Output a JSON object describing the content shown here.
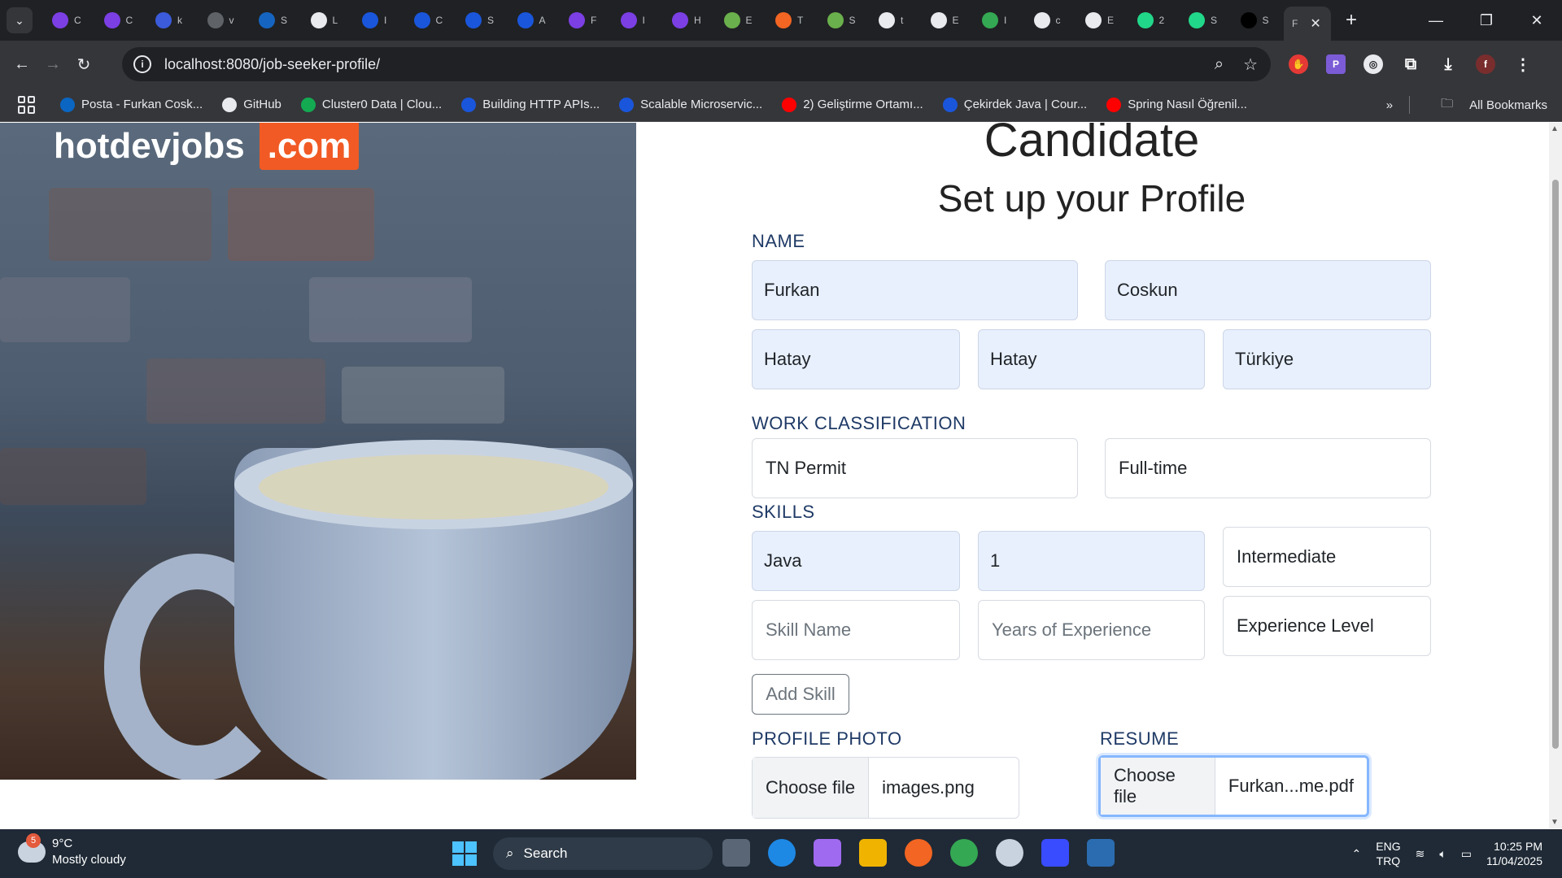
{
  "browser": {
    "tabs": [
      {
        "initial": "C",
        "color": "#7b3fe4",
        "icon": "u"
      },
      {
        "initial": "C",
        "color": "#7b3fe4",
        "icon": "u"
      },
      {
        "initial": "k",
        "color": "#3b5bdb",
        "icon": "q"
      },
      {
        "initial": "v",
        "color": "#5f6368",
        "icon": "globe"
      },
      {
        "initial": "S",
        "color": "#1565c0",
        "icon": "on"
      },
      {
        "initial": "L",
        "color": "#e8eaed",
        "icon": "w"
      },
      {
        "initial": "I",
        "color": "#1a56db",
        "icon": "c"
      },
      {
        "initial": "C",
        "color": "#1a56db",
        "icon": "c"
      },
      {
        "initial": "S",
        "color": "#1a56db",
        "icon": "c"
      },
      {
        "initial": "A",
        "color": "#1a56db",
        "icon": "c"
      },
      {
        "initial": "F",
        "color": "#7b3fe4",
        "icon": "u"
      },
      {
        "initial": "I",
        "color": "#7b3fe4",
        "icon": "u"
      },
      {
        "initial": "H",
        "color": "#7b3fe4",
        "icon": "u"
      },
      {
        "initial": "E",
        "color": "#6ab04c",
        "icon": "leaf"
      },
      {
        "initial": "T",
        "color": "#f26522",
        "icon": "b"
      },
      {
        "initial": "S",
        "color": "#6ab04c",
        "icon": "leaf"
      },
      {
        "initial": "t",
        "color": "#e8eaed",
        "icon": "gh"
      },
      {
        "initial": "E",
        "color": "#e8eaed",
        "icon": "gh"
      },
      {
        "initial": "I",
        "color": "#34a853",
        "icon": "check"
      },
      {
        "initial": "c",
        "color": "#e8eaed",
        "icon": "gh"
      },
      {
        "initial": "E",
        "color": "#e8eaed",
        "icon": "gh"
      },
      {
        "initial": "2",
        "color": "#21d789",
        "icon": "js"
      },
      {
        "initial": "S",
        "color": "#21d789",
        "icon": "js"
      },
      {
        "initial": "S",
        "color": "#000000",
        "icon": "mc"
      }
    ],
    "active_tab_initial": "F",
    "url": "localhost:8080/job-seeker-profile/",
    "bookmarks": [
      {
        "label": "Posta - Furkan Cosk...",
        "color": "#0a66c2"
      },
      {
        "label": "GitHub",
        "color": "#e8eaed"
      },
      {
        "label": "Cluster0 Data | Clou...",
        "color": "#13aa52"
      },
      {
        "label": "Building HTTP APIs...",
        "color": "#1a56db"
      },
      {
        "label": "Scalable Microservic...",
        "color": "#1a56db"
      },
      {
        "label": "2) Geliştirme Ortamı...",
        "color": "#ff0000"
      },
      {
        "label": "Çekirdek Java | Cour...",
        "color": "#1a56db"
      },
      {
        "label": "Spring Nasıl Öğrenil...",
        "color": "#ff0000"
      }
    ],
    "all_bookmarks_label": "All Bookmarks",
    "more_bookmarks_label": "»"
  },
  "page": {
    "brand_name": "hotdevjobs",
    "brand_tld": ".com",
    "title": "Candidate",
    "subtitle": "Set up your Profile",
    "sections": {
      "name": "NAME",
      "work": "WORK CLASSIFICATION",
      "skills": "SKILLS",
      "photo": "PROFILE PHOTO",
      "resume": "RESUME"
    },
    "name_fields": {
      "first_name": "Furkan",
      "last_name": "Coskun",
      "city": "Hatay",
      "state": "Hatay",
      "country": "Türkiye"
    },
    "work_fields": {
      "work_authorization": "TN Permit",
      "employment_type": "Full-time"
    },
    "skill_row": {
      "name": "Java",
      "years": "1",
      "level": "Intermediate"
    },
    "new_skill": {
      "name_placeholder": "Skill Name",
      "years_placeholder": "Years of Experience",
      "level_placeholder": "Experience Level"
    },
    "add_skill_label": "Add Skill",
    "photo_upload": {
      "button": "Choose file",
      "file": "images.png"
    },
    "resume_upload": {
      "button": "Choose file",
      "file": "Furkan...me.pdf"
    }
  },
  "taskbar": {
    "weather_badge": "5",
    "temperature": "9°C",
    "condition": "Mostly cloudy",
    "search_label": "Search",
    "lang_top": "ENG",
    "lang_bottom": "TRQ",
    "time": "10:25 PM",
    "date": "11/04/2025"
  }
}
